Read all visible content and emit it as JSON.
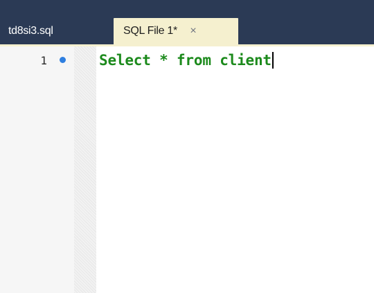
{
  "tabs": [
    {
      "label": "td8si3.sql",
      "active": false
    },
    {
      "label": "SQL File 1*",
      "active": true,
      "close_glyph": "×"
    }
  ],
  "editor": {
    "lines": [
      {
        "number": "1",
        "modified": true,
        "text": "Select * from client"
      }
    ],
    "cursor_at_end": true
  },
  "colors": {
    "tabbar_bg": "#2b3a55",
    "active_tab_bg": "#f5f0cf",
    "code_text": "#1c8a1c",
    "modified_marker": "#2f7fe0"
  },
  "icons": {
    "close": "close-icon",
    "modified": "modified-dot-icon"
  }
}
